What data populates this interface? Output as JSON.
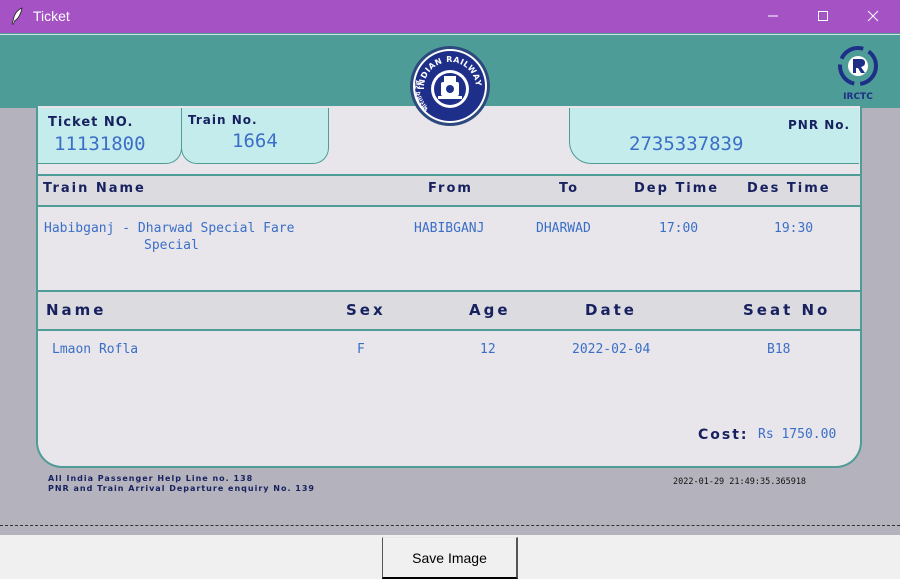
{
  "window": {
    "title": "Ticket"
  },
  "ticket": {
    "ticket_no_label": "Ticket NO.",
    "ticket_no": "11131800",
    "train_no_label": "Train No.",
    "train_no": "1664",
    "pnr_label": "PNR No.",
    "pnr": "2735337839"
  },
  "journey": {
    "headers": {
      "train_name": "Train Name",
      "from": "From",
      "to": "To",
      "dep": "Dep Time",
      "des": "Des Time"
    },
    "train_name_line1": "Habibganj - Dharwad Special Fare",
    "train_name_line2": "Special",
    "from": "HABIBGANJ",
    "to": "DHARWAD",
    "dep_time": "17:00",
    "des_time": "19:30"
  },
  "passenger": {
    "headers": {
      "name": "Name",
      "sex": "Sex",
      "age": "Age",
      "date": "Date",
      "seat": "Seat No"
    },
    "name": "Lmaon Rofla",
    "sex": "F",
    "age": "12",
    "date": "2022-02-04",
    "seat": "B18"
  },
  "cost": {
    "label": "Cost:",
    "value": "Rs 1750.00"
  },
  "footer": {
    "helpline": "All India Passenger Help Line no. 138",
    "enquiry": "PNR and Train Arrival Departure enquiry No. 139",
    "timestamp": "2022-01-29 21:49:35.365918"
  },
  "logos": {
    "railways_text": "INDIAN RAILWAYS",
    "railways_hindi": "भारतीय रेल",
    "irctc_text": "IRCTC"
  },
  "save_button_label": "Save Image",
  "colors": {
    "titlebar": "#a452c4",
    "header": "#4e9c97",
    "box": "#c5ecec",
    "accent_text": "#3b6fc7",
    "dark_text": "#17215f"
  }
}
